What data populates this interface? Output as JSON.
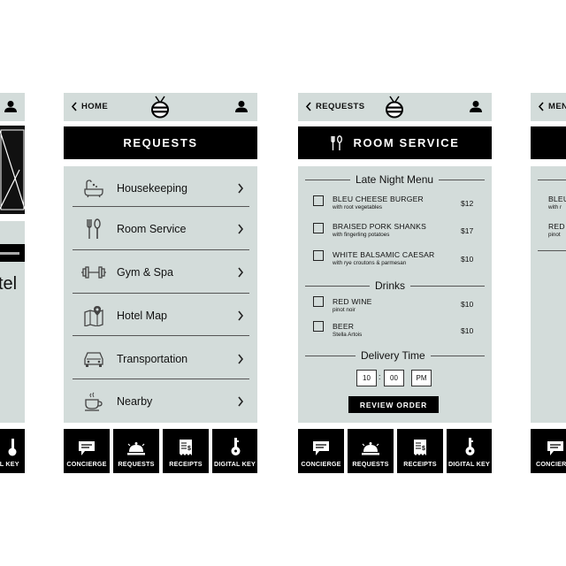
{
  "left_partial": {
    "hotel_fragment": "tel",
    "nav_label_fragment": "TAL KEY"
  },
  "screen_requests": {
    "back_label": "HOME",
    "title": "REQUESTS",
    "items": [
      {
        "label": "Housekeeping",
        "icon": "bathtub-icon"
      },
      {
        "label": "Room Service",
        "icon": "cutlery-icon"
      },
      {
        "label": "Gym & Spa",
        "icon": "dumbbell-icon"
      },
      {
        "label": "Hotel Map",
        "icon": "map-icon"
      },
      {
        "label": "Transportation",
        "icon": "car-icon"
      },
      {
        "label": "Nearby",
        "icon": "coffee-cup-icon"
      }
    ]
  },
  "screen_room_service": {
    "back_label": "REQUESTS",
    "title": "ROOM SERVICE",
    "late_night_heading": "Late Night Menu",
    "food_items": [
      {
        "name": "BLEU CHEESE BURGER",
        "sub": "with root vegetables",
        "price": "$12"
      },
      {
        "name": "BRAISED PORK SHANKS",
        "sub": "with fingerling potatoes",
        "price": "$17"
      },
      {
        "name": "WHITE BALSAMIC CAESAR",
        "sub": "with rye croutons & parmesan",
        "price": "$10"
      }
    ],
    "drinks_heading": "Drinks",
    "drink_items": [
      {
        "name": "RED WINE",
        "sub": "pinot noir",
        "price": "$10"
      },
      {
        "name": "BEER",
        "sub": "Stella Artois",
        "price": "$10"
      }
    ],
    "delivery_heading": "Delivery Time",
    "delivery": {
      "hour": "10",
      "sep": ":",
      "minute": "00",
      "ampm": "PM"
    },
    "review_button": "REVIEW ORDER"
  },
  "right_partial": {
    "back_label_fragment": "MEN",
    "item1": "BLEU",
    "item1_sub": "with r",
    "item2": "RED",
    "item2_sub": "pinot"
  },
  "nav": {
    "concierge": "CONCIERGE",
    "requests": "REQUESTS",
    "receipts": "RECEIPTS",
    "digital_key": "DIGITAL KEY",
    "concierge_fragment": "CONCIER"
  }
}
